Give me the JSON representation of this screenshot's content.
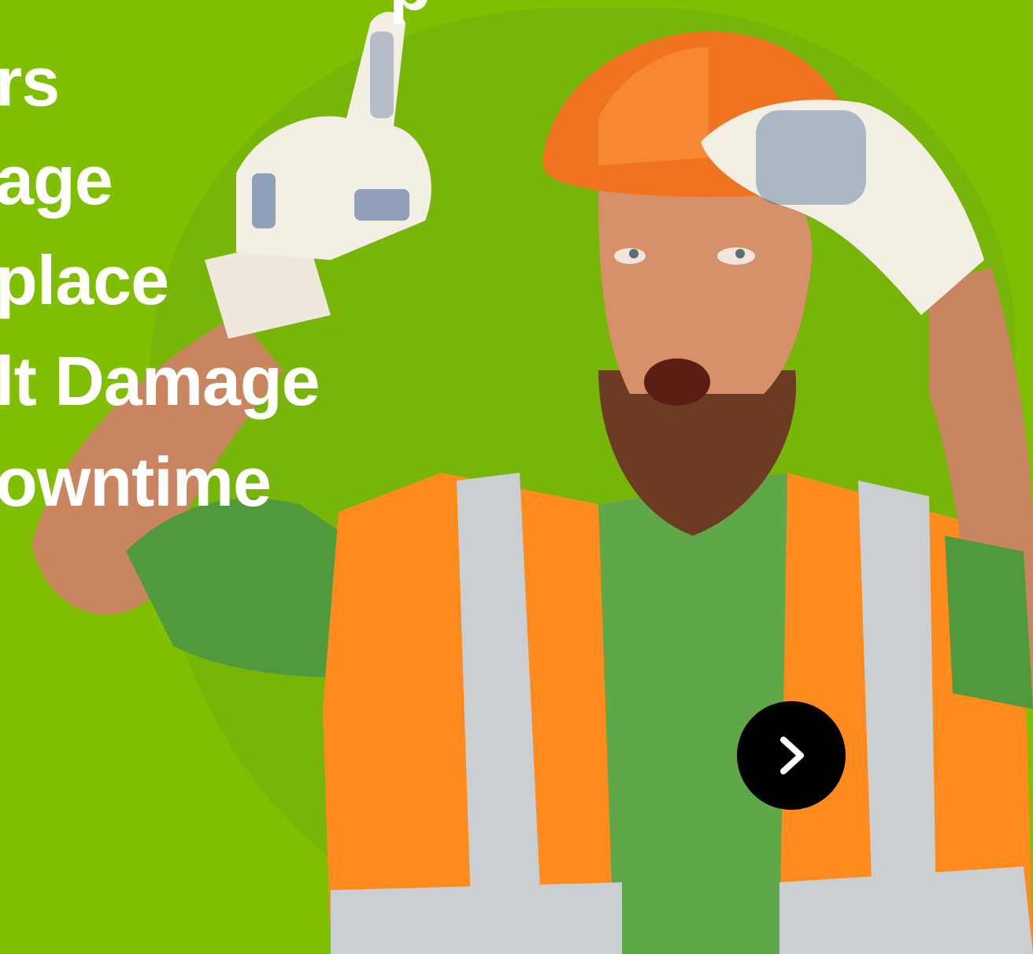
{
  "headline": {
    "lines": [
      "p",
      "rs",
      "age",
      "place",
      "lt Damage",
      "owntime"
    ]
  },
  "next_button": {
    "icon": "chevron-right-icon"
  },
  "photo": {
    "subject": "worker-photo"
  },
  "colors": {
    "background": "#7fbf00",
    "text": "#ffffff",
    "button": "#000000",
    "vest": "#ff8a1e",
    "helmet": "#f0731f",
    "shirt": "#5fa84a"
  }
}
